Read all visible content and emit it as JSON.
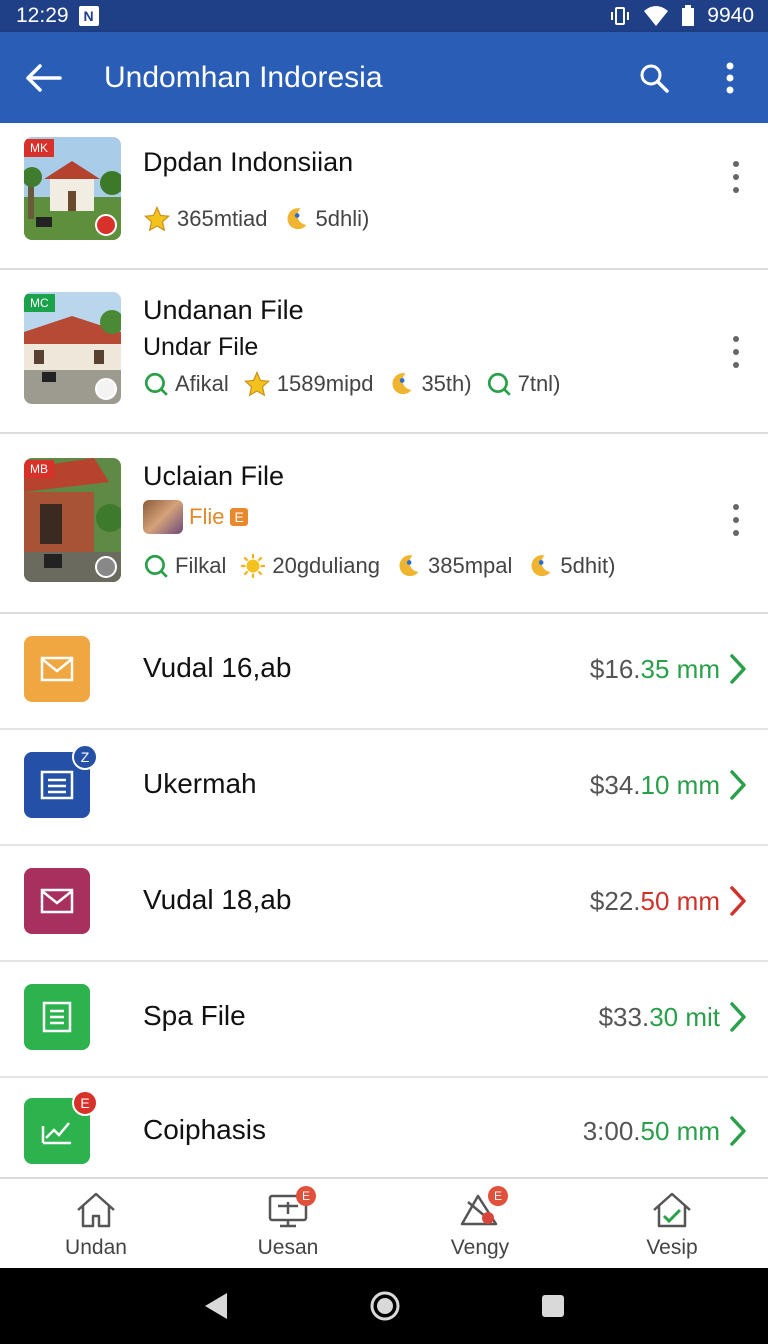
{
  "status_bar": {
    "time": "12:29",
    "notification_icon": "N",
    "battery_text": "9940",
    "icons": [
      "vibrate-icon",
      "wifi-icon",
      "battery-icon"
    ]
  },
  "app_bar": {
    "title": "Undomhan Indoresia",
    "icons": [
      "back-arrow-icon",
      "search-icon",
      "more-vert-icon"
    ]
  },
  "places": [
    {
      "tag": "MK",
      "title": "Dpdan Indonsiian",
      "meta": [
        {
          "icon": "star-icon",
          "text": "365mtiad"
        },
        {
          "icon": "moon-icon",
          "text": "5dhli)"
        }
      ]
    },
    {
      "tag": "MC",
      "title": "Undanan File",
      "subtitle": "Undar File",
      "meta": [
        {
          "icon": "search-icon",
          "text": "Afikal"
        },
        {
          "icon": "star-icon",
          "text": "1589mipd"
        },
        {
          "icon": "moon-icon",
          "text": "35th)"
        },
        {
          "icon": "search-icon",
          "text": "7tnl)"
        }
      ]
    },
    {
      "tag": "MB",
      "title": "Uclaian File",
      "chip": {
        "label": "Flie",
        "badge": "E"
      },
      "meta": [
        {
          "icon": "search-icon",
          "text": "Filkal"
        },
        {
          "icon": "sun-icon",
          "text": "20gduliang"
        },
        {
          "icon": "moon-icon",
          "text": "385mpal"
        },
        {
          "icon": "moon-icon",
          "text": "5dhit)"
        }
      ]
    }
  ],
  "rows": [
    {
      "icon": "mail-icon",
      "color": "#f0a742",
      "label": "Vudal 16,ab",
      "amount_main": "$16.",
      "amount_tail": "35 mm",
      "tail_color": "#2aa04a",
      "chev_color": "#2aa04a",
      "badge": ""
    },
    {
      "icon": "document-icon",
      "color": "#2450a8",
      "label": "Ukermah",
      "amount_main": "$34.",
      "amount_tail": "10 mm",
      "tail_color": "#2aa04a",
      "chev_color": "#2aa04a",
      "badge": "Z"
    },
    {
      "icon": "mail-icon",
      "color": "#a8305f",
      "label": "Vudal 18,ab",
      "amount_main": "$22.",
      "amount_tail": "50 mm",
      "tail_color": "#d0322a",
      "chev_color": "#d0322a",
      "badge": ""
    },
    {
      "icon": "document-icon",
      "color": "#2cb34e",
      "label": "Spa File",
      "amount_main": "$33.",
      "amount_tail": "30 mit",
      "tail_color": "#2aa04a",
      "chev_color": "#2aa04a",
      "badge": ""
    },
    {
      "icon": "edit-chart-icon",
      "color": "#2cb34e",
      "label": "Coiphasis",
      "amount_main": "3:00.",
      "amount_tail": "50 mm",
      "tail_color": "#2aa04a",
      "chev_color": "#2aa04a",
      "badge": "E"
    }
  ],
  "bottom_nav": [
    {
      "icon": "home-icon",
      "label": "Undan",
      "badge": ""
    },
    {
      "icon": "monitor-icon",
      "label": "Uesan",
      "badge": "E"
    },
    {
      "icon": "tag-icon",
      "label": "Vengy",
      "badge": "E"
    },
    {
      "icon": "house-check-icon",
      "label": "Vesip",
      "badge": ""
    }
  ],
  "system_nav": [
    "back-triangle-icon",
    "home-circle-icon",
    "recents-square-icon"
  ]
}
